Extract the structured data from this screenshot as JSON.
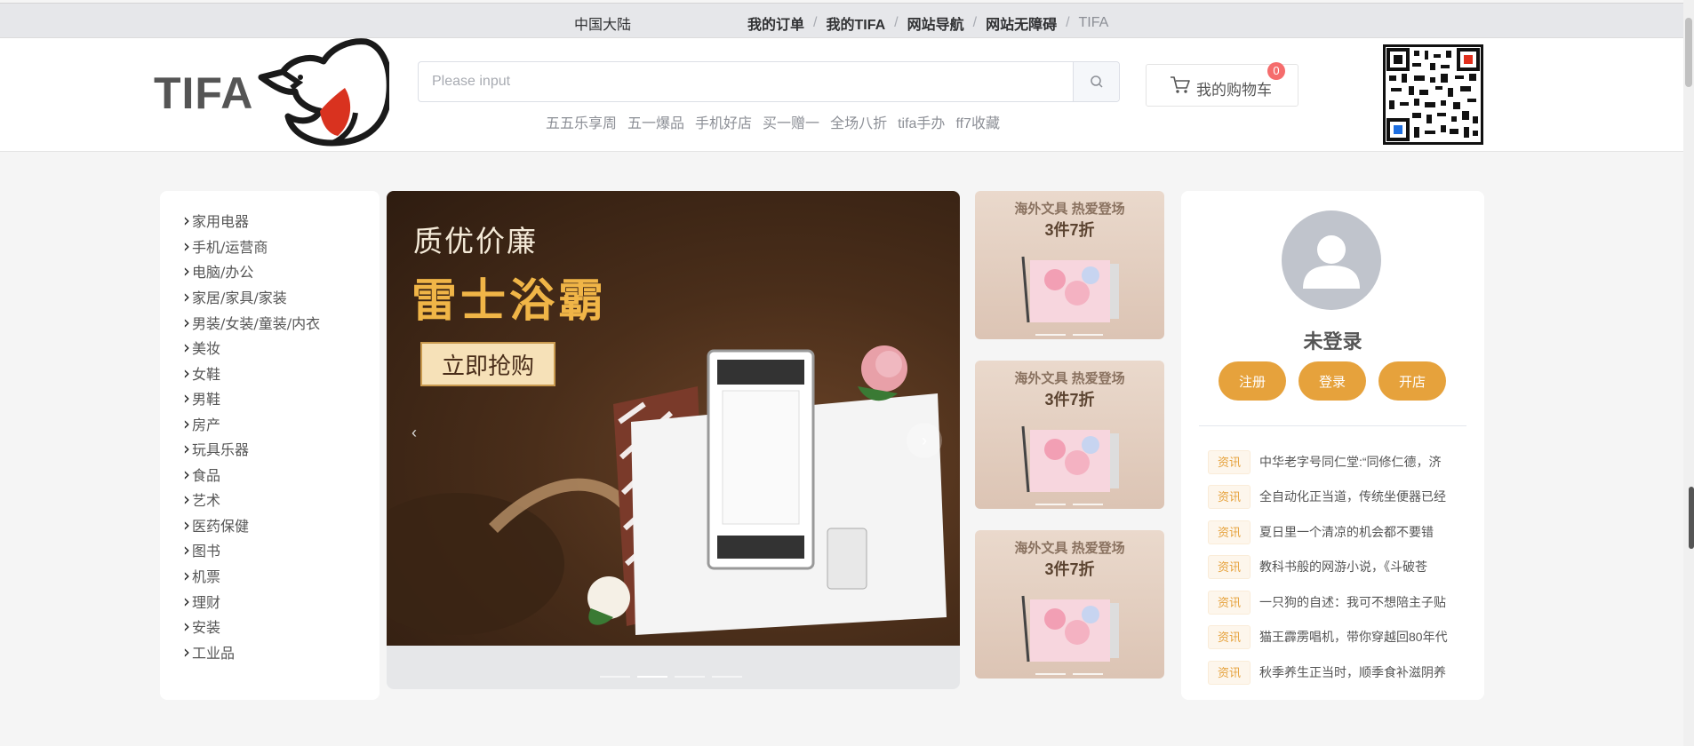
{
  "topbar": {
    "region": "中国大陆",
    "links": [
      {
        "label": "我的订单"
      },
      {
        "label": "我的TIFA"
      },
      {
        "label": "网站导航"
      },
      {
        "label": "网站无障碍"
      },
      {
        "label": "TIFA"
      }
    ],
    "separator": "/"
  },
  "header": {
    "logo_text": "TIFA",
    "search": {
      "placeholder": "Please input",
      "value": ""
    },
    "hotwords": [
      "五五乐享周",
      "五一爆品",
      "手机好店",
      "买一赠一",
      "全场八折",
      "tifa手办",
      "ff7收藏"
    ],
    "cart": {
      "label": "我的购物车",
      "count": "0"
    }
  },
  "categories": [
    "家用电器",
    "手机/运营商",
    "电脑/办公",
    "家居/家具/家装",
    "男装/女装/童装/内衣",
    "美妆",
    "女鞋",
    "男鞋",
    "房产",
    "玩具乐器",
    "食品",
    "艺术",
    "医药保健",
    "图书",
    "机票",
    "理财",
    "安装",
    "工业品"
  ],
  "carousel": {
    "title_line1": "质优价廉",
    "title_line2": "雷士浴霸",
    "cta": "立即抢购",
    "prev_arrow": "‹",
    "next_arrow": "›",
    "slide_count": 4,
    "active_index": 1
  },
  "promos": [
    {
      "line1": "海外文具 热爱登场",
      "line2": "3件7折"
    },
    {
      "line1": "海外文具 热爱登场",
      "line2": "3件7折"
    },
    {
      "line1": "海外文具 热爱登场",
      "line2": "3件7折"
    }
  ],
  "user": {
    "name": "未登录",
    "buttons": [
      "注册",
      "登录",
      "开店"
    ]
  },
  "news": [
    {
      "tag": "资讯",
      "text": "中华老字号同仁堂:“同修仁德，济"
    },
    {
      "tag": "资讯",
      "text": "全自动化正当道，传统坐便器已经"
    },
    {
      "tag": "资讯",
      "text": "夏日里一个清凉的机会都不要错"
    },
    {
      "tag": "资讯",
      "text": "教科书般的网游小说，《斗破苍"
    },
    {
      "tag": "资讯",
      "text": "一只狗的自述：我可不想陪主子贴"
    },
    {
      "tag": "资讯",
      "text": "猫王霹雳唱机，带你穿越回80年代"
    },
    {
      "tag": "资讯",
      "text": "秋季养生正当时，顺季食补滋阴养"
    }
  ],
  "colors": {
    "accent": "#e6a23c",
    "badge": "#f56c6c",
    "banner_title": "#f0b547"
  }
}
